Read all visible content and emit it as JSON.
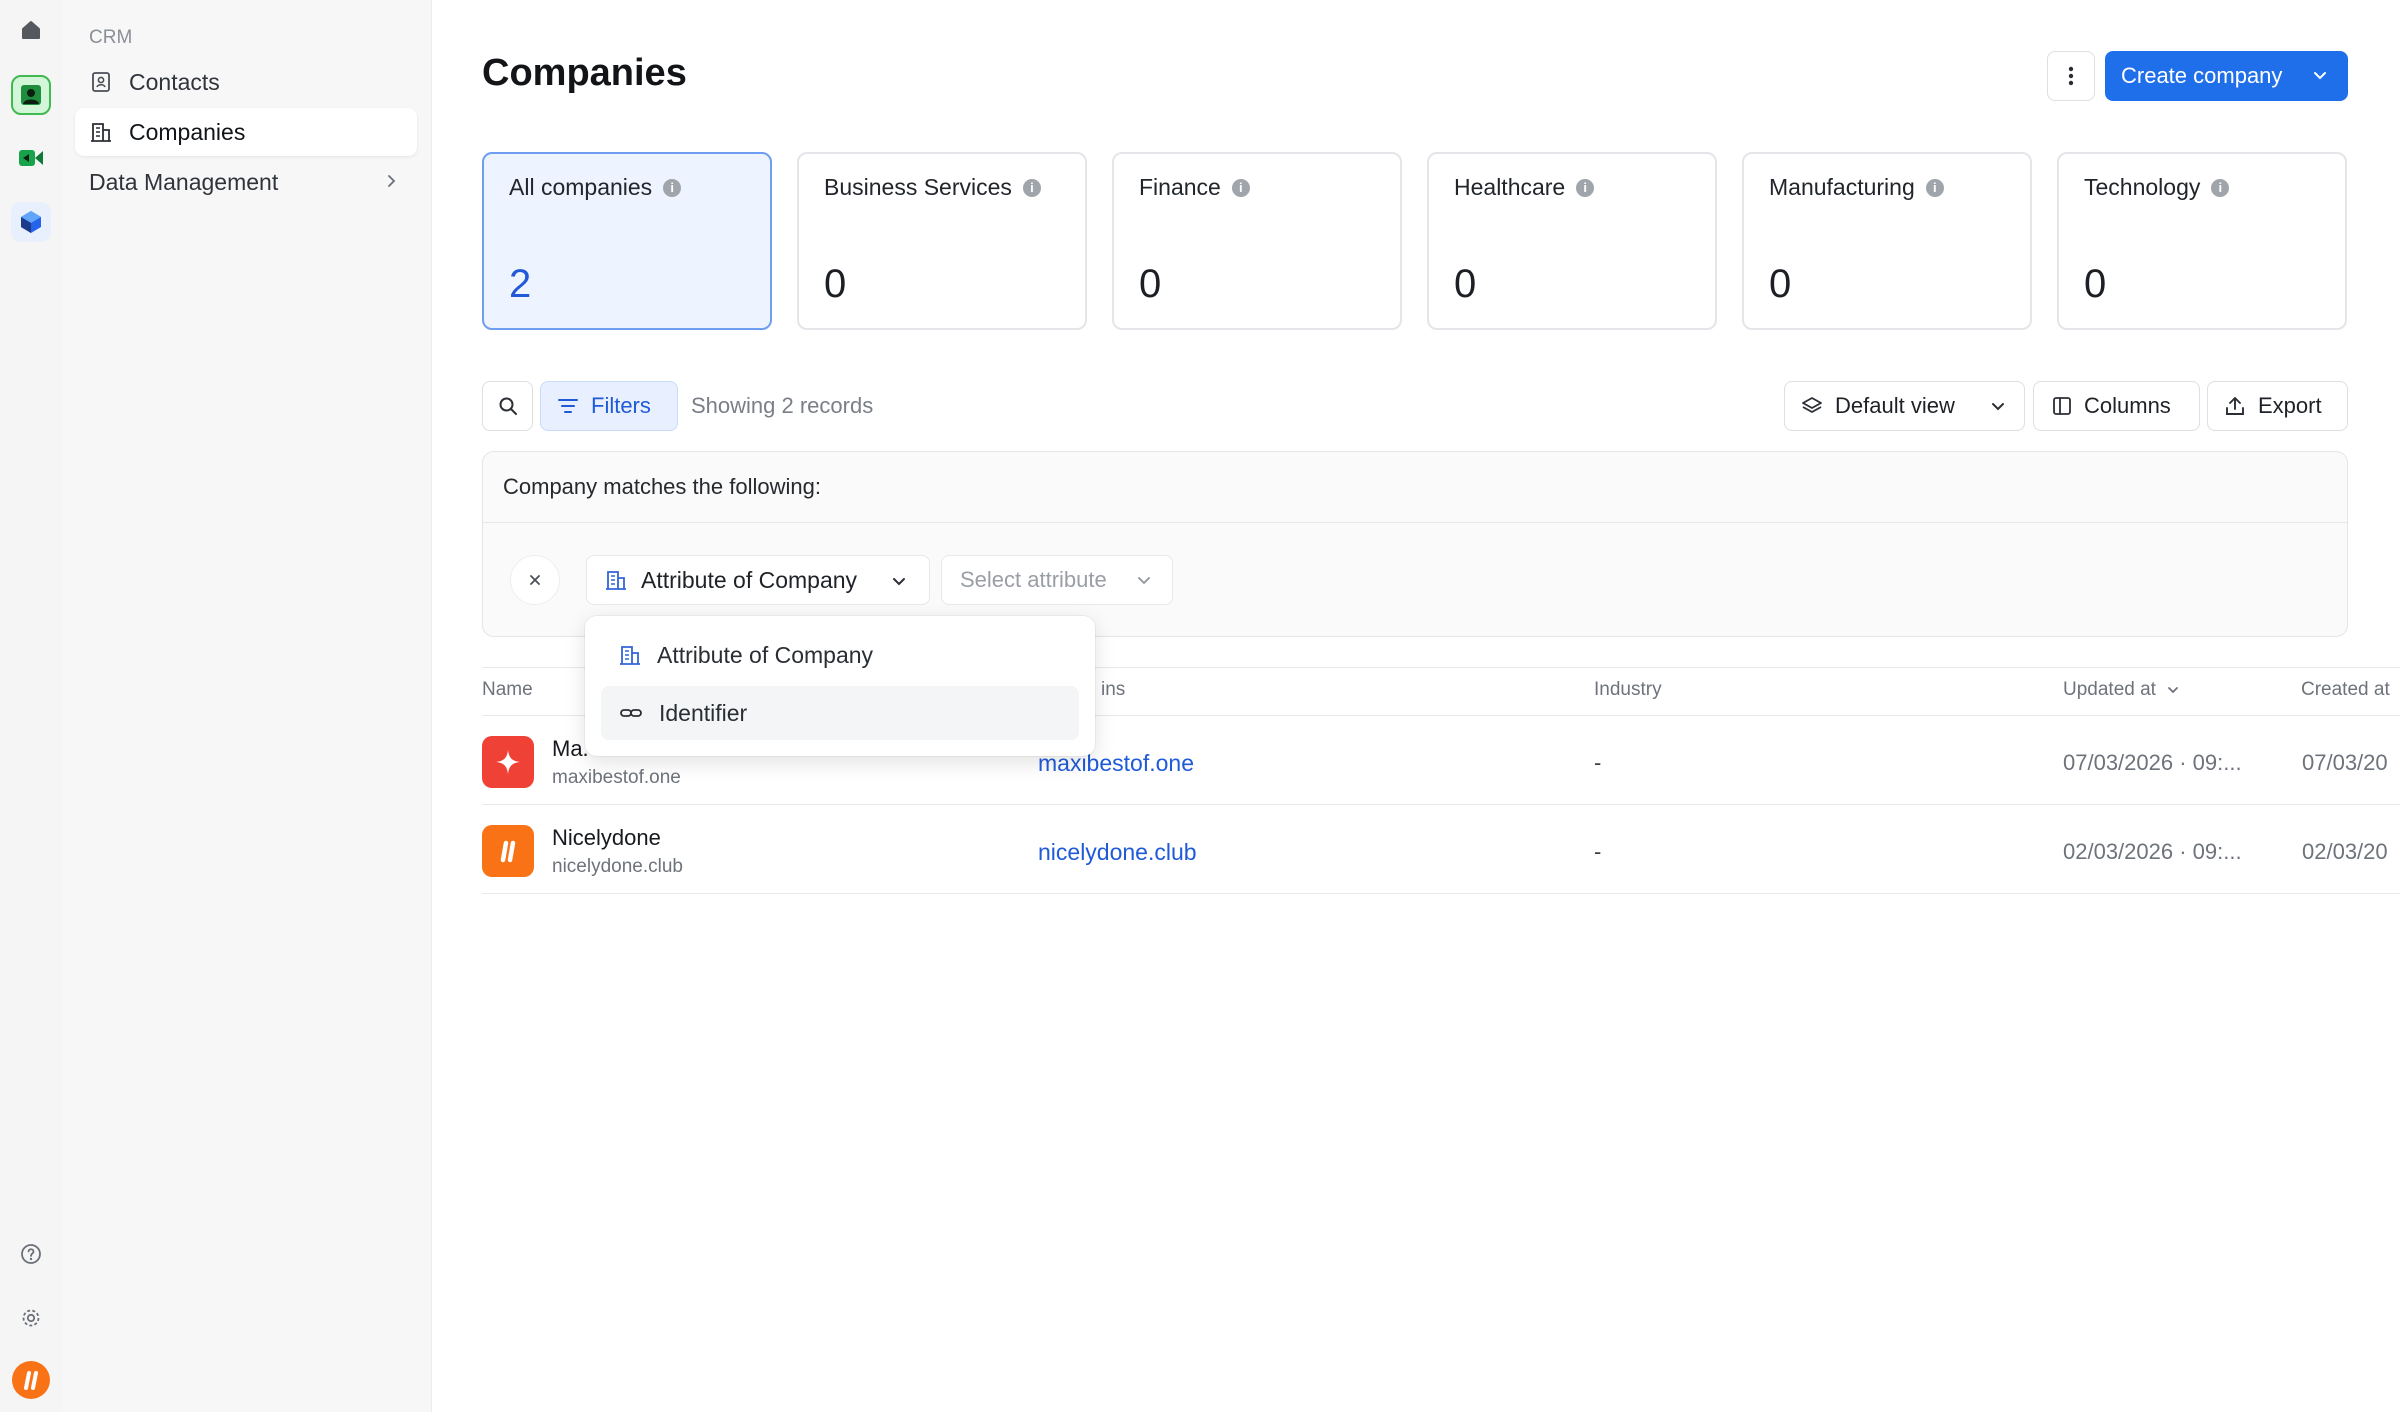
{
  "sidebar": {
    "section_label": "CRM",
    "items": [
      {
        "label": "Contacts",
        "icon": "contact-card-icon"
      },
      {
        "label": "Companies",
        "icon": "building-icon",
        "active": true
      },
      {
        "label": "Data Management",
        "icon": "chevron-right-icon"
      }
    ]
  },
  "header": {
    "title": "Companies",
    "create_label": "Create company"
  },
  "segments": [
    {
      "label": "All companies",
      "count": "2",
      "active": true
    },
    {
      "label": "Business Services",
      "count": "0"
    },
    {
      "label": "Finance",
      "count": "0"
    },
    {
      "label": "Healthcare",
      "count": "0"
    },
    {
      "label": "Manufacturing",
      "count": "0"
    },
    {
      "label": "Technology",
      "count": "0"
    }
  ],
  "toolbar": {
    "filters_label": "Filters",
    "records_text": "Showing 2 records",
    "view_label": "Default view",
    "columns_label": "Columns",
    "export_label": "Export"
  },
  "filter": {
    "heading": "Company matches the following:",
    "attribute_label": "Attribute of Company",
    "select_placeholder": "Select attribute"
  },
  "menu": {
    "items": [
      "Attribute of Company",
      "Identifier"
    ]
  },
  "table": {
    "columns": [
      "Name",
      "ins",
      "Industry",
      "Updated at",
      "Created at"
    ],
    "rows": [
      {
        "name": "Ma.",
        "domain": "maxibestof.one",
        "link": "maxibestof.one",
        "industry": "-",
        "updated": "07/03/2026 · 09:...",
        "created": "07/03/20",
        "logo_color": "#ef4136"
      },
      {
        "name": "Nicelydone",
        "domain": "nicelydone.club",
        "link": "nicelydone.club",
        "industry": "-",
        "updated": "02/03/2026 · 09:...",
        "created": "02/03/20",
        "logo_color": "#f97316"
      }
    ]
  },
  "colors": {
    "accent": "#1f6feb",
    "link": "#1f5ad8"
  }
}
